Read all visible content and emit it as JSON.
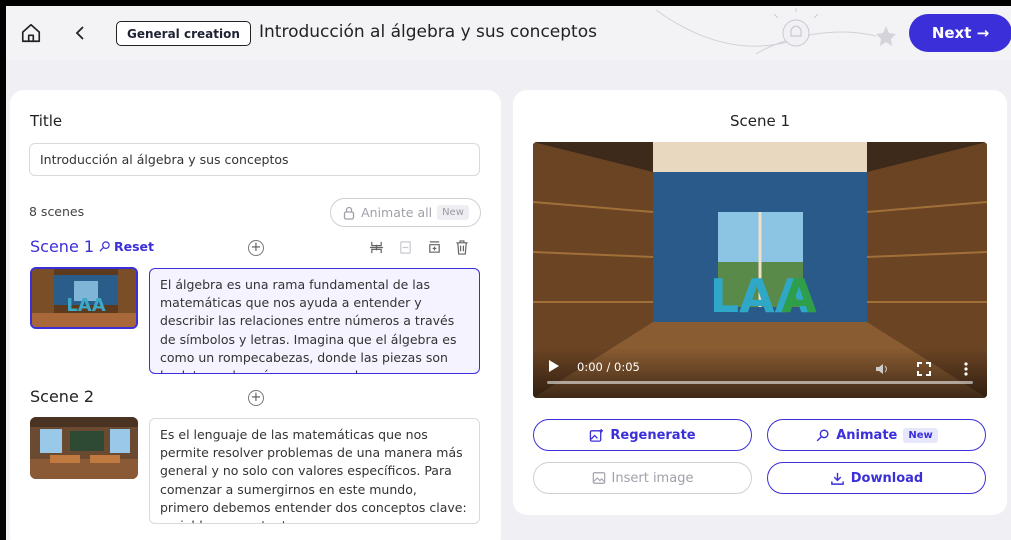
{
  "header": {
    "badge_label": "General creation",
    "page_title": "Introducción al álgebra y sus conceptos",
    "next_label": "Next →"
  },
  "editor": {
    "title_label": "Title",
    "title_value": "Introducción al álgebra y sus conceptos",
    "scene_count": "8 scenes",
    "animate_all_label": "Animate all",
    "new_tag": "New",
    "scenes": [
      {
        "label": "Scene 1",
        "reset_label": "Reset",
        "text": "El álgebra es una rama fundamental de las matemáticas que nos ayuda a entender y describir las relaciones entre números a través de símbolos y letras. Imagina que el álgebra es como un rompecabezas, donde las piezas son las letras y los números que colocamos para"
      },
      {
        "label": "Scene 2",
        "text": "Es el lenguaje de las matemáticas que nos permite resolver problemas de una manera más general y no solo con valores específicos. Para comenzar a sumergirnos en este mundo, primero debemos entender dos conceptos clave: variables y constantes."
      }
    ]
  },
  "preview": {
    "heading": "Scene 1",
    "time": "0:00 / 0:05",
    "actions": {
      "regenerate": "Regenerate",
      "animate": "Animate",
      "animate_tag": "New",
      "insert_image": "Insert image",
      "download": "Download"
    }
  },
  "colors": {
    "accent": "#3b2fd9"
  }
}
